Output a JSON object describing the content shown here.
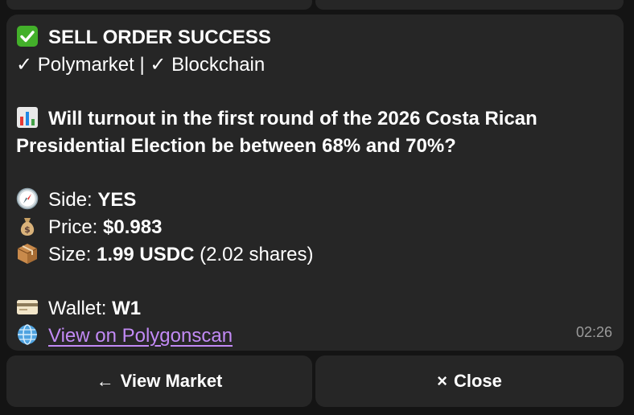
{
  "message": {
    "status_check_emoji": "✅",
    "status_text": "SELL ORDER SUCCESS",
    "sources_line": "✓ Polymarket | ✓ Blockchain",
    "market_question": "Will turnout in the first round of the 2026 Costa Rican Presidential Election be between 68% and 70%?",
    "side_label": "Side:",
    "side_value": "YES",
    "price_label": "Price:",
    "price_value": "$0.983",
    "size_label": "Size:",
    "size_value": "1.99 USDC",
    "size_shares": "(2.02 shares)",
    "wallet_label": "Wallet:",
    "wallet_value": "W1",
    "link_text": "View on Polygonscan",
    "timestamp": "02:26"
  },
  "buttons": {
    "view_market_arrow": "←",
    "view_market": "View Market",
    "close_icon": "×",
    "close": "Close"
  },
  "icons": {
    "status": "check-mark-icon",
    "market": "bar-chart-icon",
    "side": "compass-icon",
    "price": "money-bag-icon",
    "size": "package-icon",
    "wallet": "credit-card-icon",
    "link": "globe-icon"
  },
  "colors": {
    "background": "#141414",
    "bubble": "#262626",
    "link": "#c28af5",
    "check_green": "#43b02a",
    "timestamp": "#9a9a9a"
  }
}
